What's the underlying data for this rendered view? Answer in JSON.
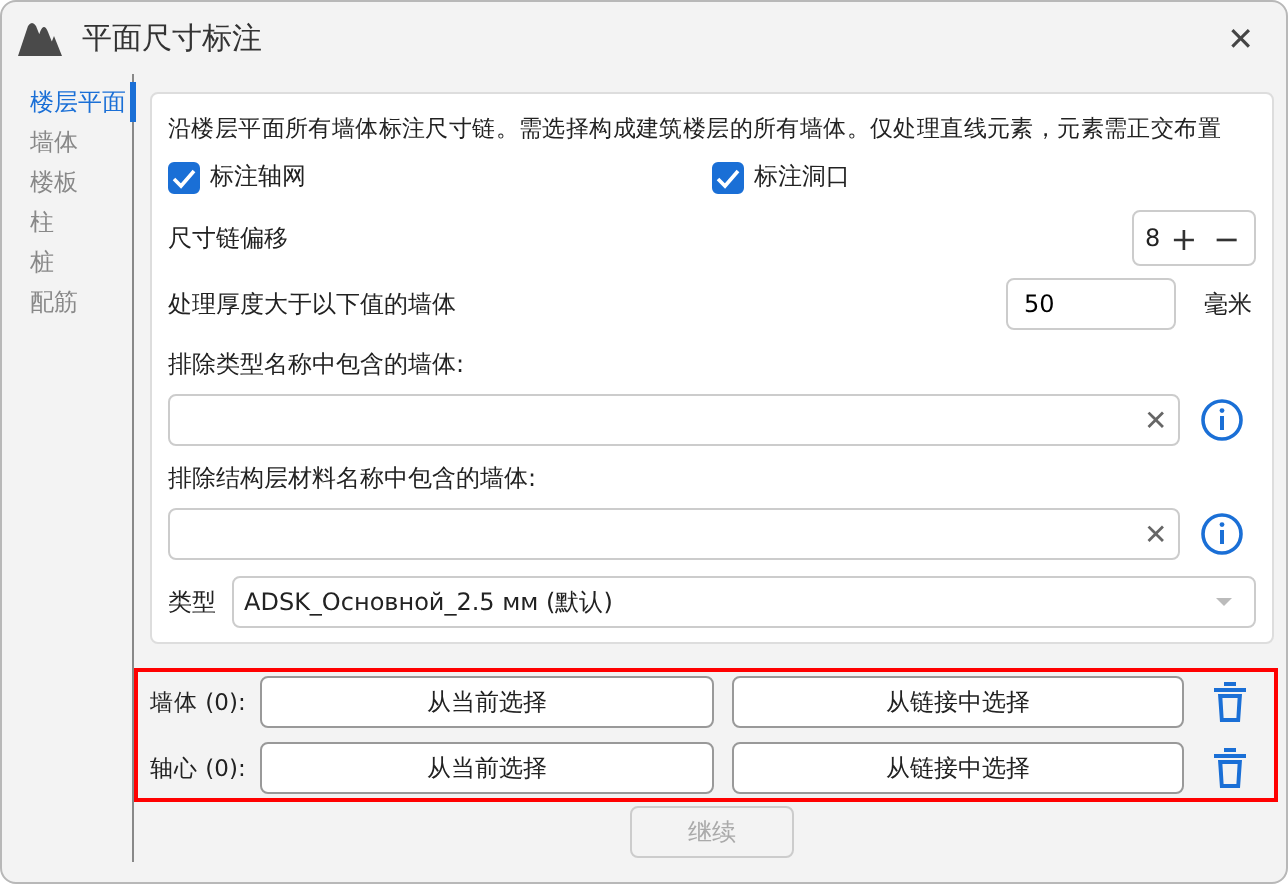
{
  "window": {
    "title": "平面尺寸标注",
    "close": "✕"
  },
  "sidebar": {
    "items": [
      {
        "label": "楼层平面",
        "selected": true
      },
      {
        "label": "墙体",
        "selected": false
      },
      {
        "label": "楼板",
        "selected": false
      },
      {
        "label": "柱",
        "selected": false
      },
      {
        "label": "桩",
        "selected": false
      },
      {
        "label": "配筋",
        "selected": false
      }
    ]
  },
  "description": "沿楼层平面所有墙体标注尺寸链。需选择构成建筑楼层的所有墙体。仅处理直线元素，元素需正交布置",
  "checkboxes": [
    {
      "label": "标注轴网",
      "checked": true
    },
    {
      "label": "标注洞口",
      "checked": true
    }
  ],
  "offset": {
    "label": "尺寸链偏移",
    "value": "8",
    "plus": "+",
    "minus": "−"
  },
  "thickness": {
    "label": "处理厚度大于以下值的墙体",
    "value": "50",
    "unit": "毫米"
  },
  "exclude_fields": [
    {
      "label": "排除类型名称中包含的墙体:",
      "clear": "✕"
    },
    {
      "label": "排除结构层材料名称中包含的墙体:",
      "clear": "✕"
    }
  ],
  "type": {
    "label": "类型",
    "value": "ADSK_Основной_2.5 мм (默认)"
  },
  "selection": {
    "highlighted": true,
    "rows": [
      {
        "label": "墙体 (0):",
        "buttons": [
          "从当前选择",
          "从链接中选择"
        ]
      },
      {
        "label": "轴心 (0):",
        "buttons": [
          "从当前选择",
          "从链接中选择"
        ]
      }
    ]
  },
  "continue_button": {
    "label": "继续",
    "disabled": true
  }
}
